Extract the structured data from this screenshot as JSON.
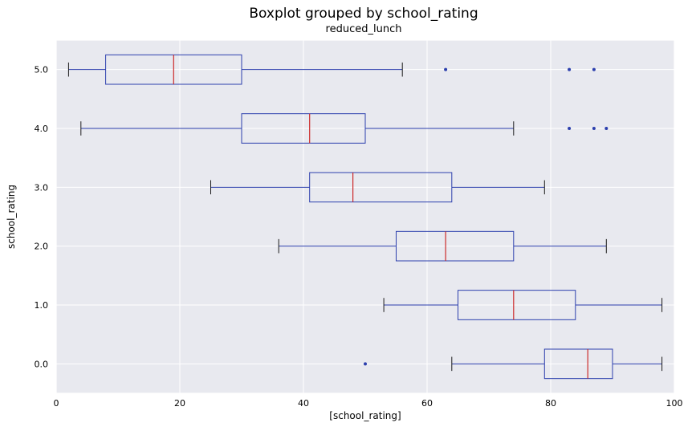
{
  "chart_data": {
    "type": "boxplot",
    "orientation": "horizontal",
    "title": "Boxplot grouped by school_rating",
    "subtitle": "reduced_lunch",
    "xlabel": "[school_rating]",
    "ylabel": "school_rating",
    "xlim": [
      0,
      100
    ],
    "xticks": [
      0,
      20,
      40,
      60,
      80,
      100
    ],
    "categories": [
      "5.0",
      "4.0",
      "3.0",
      "2.0",
      "1.0",
      "0.0"
    ],
    "series": [
      {
        "name": "5.0",
        "whisker_low": 2,
        "q1": 8,
        "median": 19,
        "q3": 30,
        "whisker_high": 56,
        "outliers": [
          63,
          83,
          87
        ]
      },
      {
        "name": "4.0",
        "whisker_low": 4,
        "q1": 30,
        "median": 41,
        "q3": 50,
        "whisker_high": 74,
        "outliers": [
          83,
          87,
          89
        ]
      },
      {
        "name": "3.0",
        "whisker_low": 25,
        "q1": 41,
        "median": 48,
        "q3": 64,
        "whisker_high": 79,
        "outliers": []
      },
      {
        "name": "2.0",
        "whisker_low": 36,
        "q1": 55,
        "median": 63,
        "q3": 74,
        "whisker_high": 89,
        "outliers": []
      },
      {
        "name": "1.0",
        "whisker_low": 53,
        "q1": 65,
        "median": 74,
        "q3": 84,
        "whisker_high": 98,
        "outliers": []
      },
      {
        "name": "0.0",
        "whisker_low": 64,
        "q1": 79,
        "median": 86,
        "q3": 90,
        "whisker_high": 98,
        "outliers": [
          50
        ]
      }
    ]
  }
}
